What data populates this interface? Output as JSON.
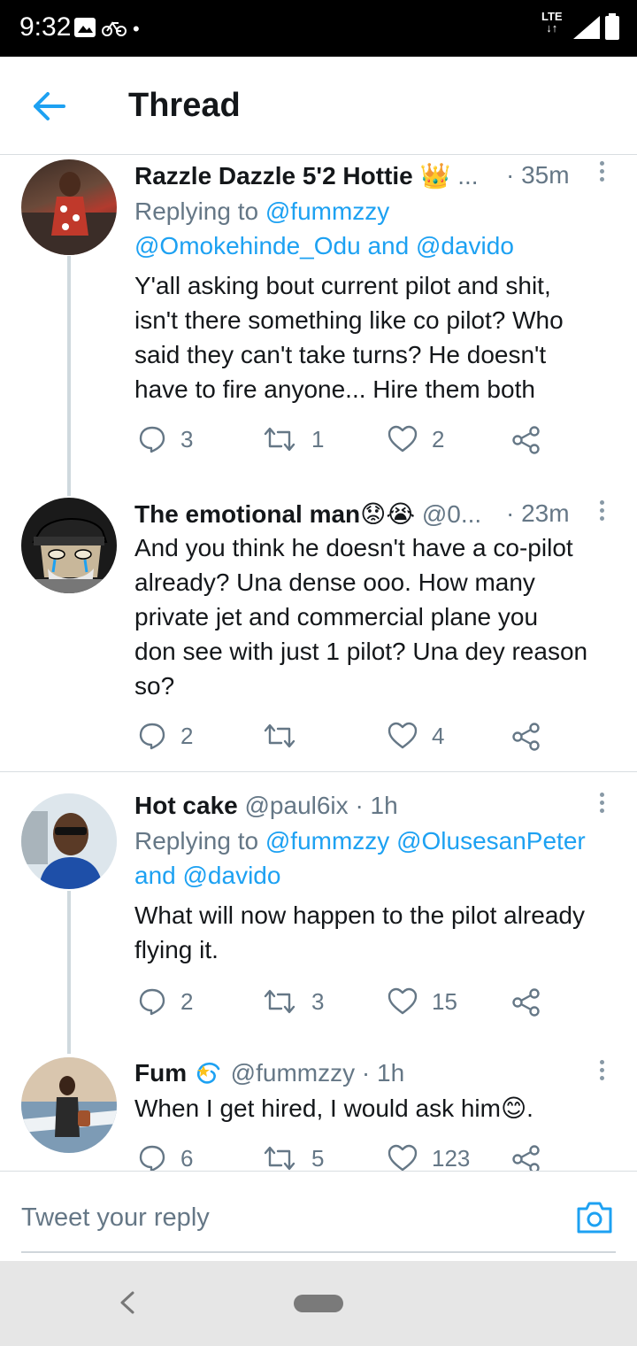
{
  "status_bar": {
    "time": "9:32",
    "network": "LTE",
    "dot": "•"
  },
  "header": {
    "title": "Thread"
  },
  "tweets": [
    {
      "name": "Razzle Dazzle 5'2 Hottie 👑",
      "handle": "...",
      "time": "· 35m",
      "replying_prefix": "Replying to",
      "replying_line1": "@fummzzy",
      "replying_line2a": "@Omokehinde_Odu",
      "replying_and": "and",
      "replying_line2b": "@davido",
      "body": [
        "Y'all asking bout current pilot and shit,",
        "isn't there something like co pilot? Who",
        "said they can't take turns? He doesn't",
        "have to fire anyone... Hire them both"
      ],
      "replies": "3",
      "retweets": "1",
      "likes": "2"
    },
    {
      "name": "The emotional man😟😭",
      "handle": "@0...",
      "time": "· 23m",
      "body": [
        "And you think he doesn't have a co-pilot",
        "already? Una dense ooo. How many",
        "private jet and commercial plane you",
        "don see with just 1 pilot? Una dey reason",
        "so?"
      ],
      "replies": "2",
      "retweets": "",
      "likes": "4"
    },
    {
      "name": "Hot cake",
      "handle": "@paul6ix",
      "time": "· 1h",
      "replying_prefix": "Replying to",
      "replying_a": "@fummzzy",
      "replying_b": "@OlusesanPeter",
      "replying_and": "and",
      "replying_c": "@davido",
      "body": [
        "What will now happen to the pilot already",
        "flying it."
      ],
      "replies": "2",
      "retweets": "3",
      "likes": "15"
    },
    {
      "name": "Fum",
      "handle": "@fummzzy",
      "time": "· 1h",
      "body": [
        "When I get hired, I would ask him😊."
      ],
      "replies": "6",
      "retweets": "5",
      "likes": "123"
    }
  ],
  "reply_bar": {
    "placeholder": "Tweet your reply"
  },
  "icons": {
    "back": "arrow-left-icon",
    "reply": "comment-icon",
    "retweet": "retweet-icon",
    "like": "heart-icon",
    "share": "share-icon",
    "camera": "camera-icon",
    "more": "more-vertical-icon"
  },
  "colors": {
    "accent": "#1da1f2",
    "muted": "#657786",
    "text": "#14171a"
  }
}
